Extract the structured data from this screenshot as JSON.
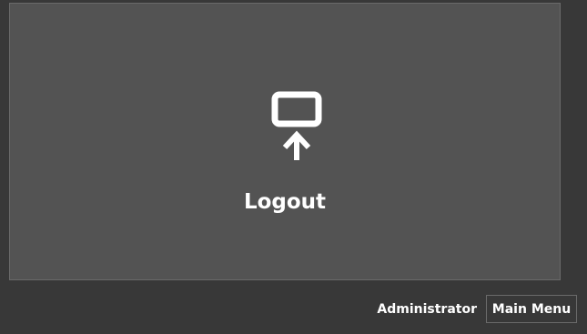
{
  "logout_tile": {
    "icon": "logout-screen-arrow-icon",
    "label": "Logout"
  },
  "footer": {
    "user_label": "Administrator",
    "main_menu_label": "Main Menu"
  },
  "colors": {
    "background": "#383838",
    "tile": "#535353",
    "border": "#6a6a6a",
    "text": "#ffffff"
  }
}
